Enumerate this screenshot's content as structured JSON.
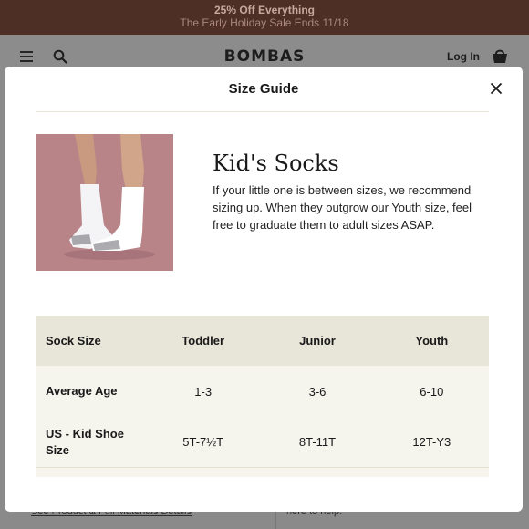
{
  "promo": {
    "line1": "25% Off Everything",
    "line2": "The Early Holiday Sale Ends 11/18"
  },
  "header": {
    "logo": "BOMBAS",
    "login": "Log In"
  },
  "background": {
    "bottom_left_link": "See Product & Full Materials Details",
    "bottom_right_text": "here to help."
  },
  "modal": {
    "title": "Size Guide",
    "product": {
      "name": "Kid's Socks",
      "description": "If your little one is between sizes, we recommend sizing up. When they outgrow our Youth size, feel free to graduate them to adult sizes ASAP."
    },
    "table": {
      "header": {
        "label": "Sock Size",
        "cols": [
          "Toddler",
          "Junior",
          "Youth"
        ]
      },
      "rows": [
        {
          "label": "Average Age",
          "values": [
            "1-3",
            "3-6",
            "6-10"
          ]
        },
        {
          "label": "US - Kid Shoe Size",
          "values": [
            "5T-7½T",
            "8T-11T",
            "12T-Y3"
          ]
        }
      ]
    }
  },
  "icons": [
    "hamburger-icon",
    "search-icon",
    "cart-icon",
    "close-icon"
  ],
  "colors": {
    "promo_bg": "#4d2f26",
    "table_head": "#e8e6d9",
    "table_body": "#f5f4ed",
    "image_bg": "#b98487"
  }
}
